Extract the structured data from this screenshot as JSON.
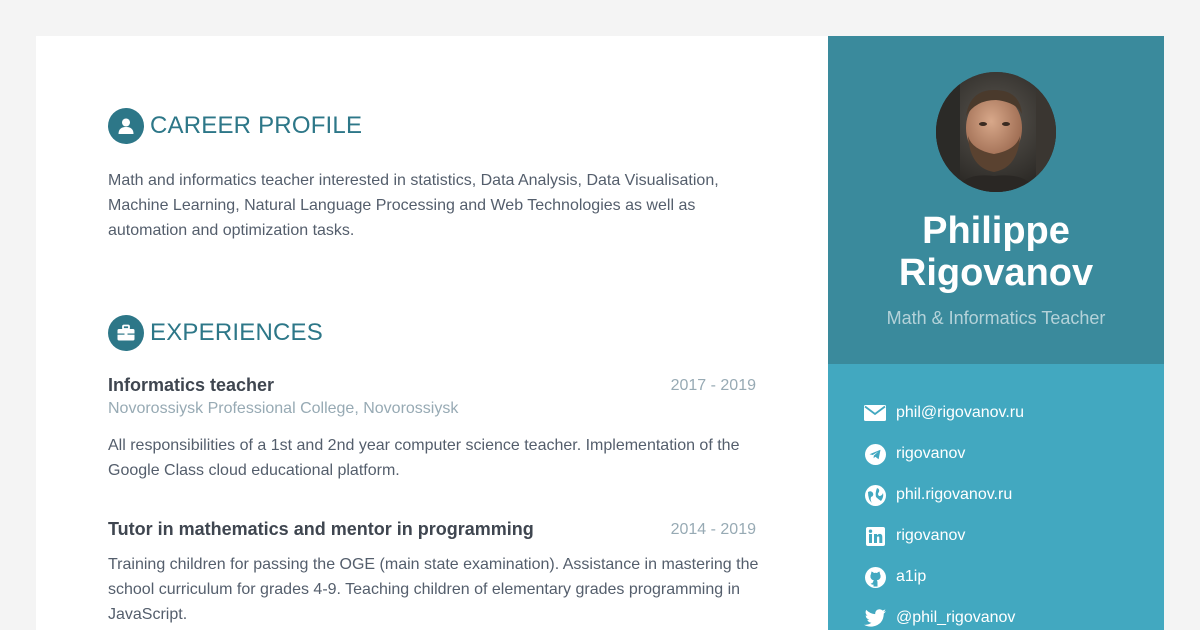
{
  "sidebar": {
    "name": "Philippe Rigovanov",
    "tagline": "Math & Informatics Teacher",
    "contacts": [
      {
        "icon": "envelope-icon",
        "text": "phil@rigovanov.ru"
      },
      {
        "icon": "telegram-icon",
        "text": "rigovanov"
      },
      {
        "icon": "globe-icon",
        "text": "phil.rigovanov.ru"
      },
      {
        "icon": "linkedin-icon",
        "text": "rigovanov"
      },
      {
        "icon": "github-icon",
        "text": "a1ip"
      },
      {
        "icon": "twitter-icon",
        "text": "@phil_rigovanov"
      }
    ]
  },
  "main": {
    "career": {
      "title": "CAREER PROFILE",
      "icon": "user-icon",
      "text": "Math and informatics teacher interested in statistics, Data Analysis, Data Visualisation, Machine Learning, Natural Language Processing and Web Technologies as well as automation and optimization tasks."
    },
    "experiences": {
      "title": "EXPERIENCES",
      "icon": "briefcase-icon",
      "items": [
        {
          "title": "Informatics teacher",
          "date": "2017 - 2019",
          "company": "Novorossiysk Professional College, Novorossiysk",
          "description": "All responsibilities of a 1st and 2nd year computer science teacher. Implementation of the Google Class cloud educational platform."
        },
        {
          "title": "Tutor in mathematics and mentor in programming",
          "date": "2014 - 2019",
          "description": "Training children for passing the OGE (main state examination). Assistance in mastering the school curriculum for grades 4-9. Teaching children of elementary grades programming in JavaScript."
        }
      ]
    }
  },
  "colors": {
    "accent": "#2d7788",
    "profile_bg": "#3a8a9c",
    "sidebar_bg": "#42a8c0",
    "muted": "#97aab4"
  }
}
